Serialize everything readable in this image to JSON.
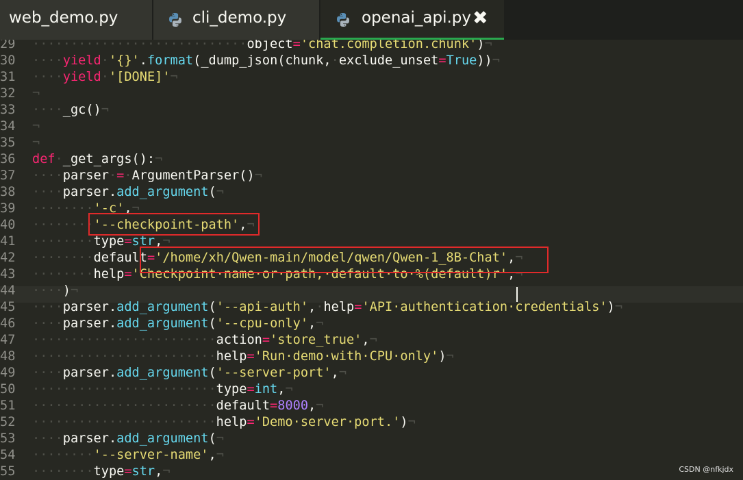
{
  "tabs": [
    {
      "label": "web_demo.py",
      "active": false,
      "icon": "python-icon"
    },
    {
      "label": "cli_demo.py",
      "active": false,
      "icon": "python-icon"
    },
    {
      "label": "openai_api.py",
      "active": true,
      "icon": "python-icon",
      "close": "✖"
    }
  ],
  "colors": {
    "keyword": "#f92672",
    "string": "#e6db74",
    "builtin": "#66d9ef",
    "number": "#ae81ff",
    "highlight_box": "#e02a2a",
    "active_tab_underline": "#2aa84e"
  },
  "lines": [
    {
      "n": "29",
      "t": "····························object='chat.completion.chunk')¬"
    },
    {
      "n": "30",
      "t": "····yield·'{}'.format(_dump_json(chunk,·exclude_unset=True))¬"
    },
    {
      "n": "31",
      "t": "····yield·'[DONE]'¬"
    },
    {
      "n": "32",
      "t": "¬"
    },
    {
      "n": "33",
      "t": "····_gc()¬"
    },
    {
      "n": "34",
      "t": "¬"
    },
    {
      "n": "35",
      "t": "¬"
    },
    {
      "n": "36",
      "t": "def·_get_args():¬"
    },
    {
      "n": "37",
      "t": "····parser·=·ArgumentParser()¬"
    },
    {
      "n": "38",
      "t": "····parser.add_argument(¬"
    },
    {
      "n": "39",
      "t": "········'-c',¬"
    },
    {
      "n": "40",
      "t": "········'--checkpoint-path',¬"
    },
    {
      "n": "41",
      "t": "········type=str,¬"
    },
    {
      "n": "42",
      "t": "········default='/home/xh/Qwen-main/model/qwen/Qwen-1_8B-Chat',¬"
    },
    {
      "n": "43",
      "t": "········help='Checkpoint·name·or·path,·default·to·%(default)r',¬"
    },
    {
      "n": "44",
      "t": "····)¬"
    },
    {
      "n": "45",
      "t": "····parser.add_argument('--api-auth',·help='API·authentication·credentials')¬"
    },
    {
      "n": "46",
      "t": "····parser.add_argument('--cpu-only',¬"
    },
    {
      "n": "47",
      "t": "························action='store_true',¬"
    },
    {
      "n": "48",
      "t": "························help='Run·demo·with·CPU·only')¬"
    },
    {
      "n": "49",
      "t": "····parser.add_argument('--server-port',¬"
    },
    {
      "n": "50",
      "t": "························type=int,¬"
    },
    {
      "n": "51",
      "t": "························default=8000,¬"
    },
    {
      "n": "52",
      "t": "························help='Demo·server·port.')¬"
    },
    {
      "n": "53",
      "t": "····parser.add_argument(¬"
    },
    {
      "n": "54",
      "t": "········'--server-name',¬"
    },
    {
      "n": "55",
      "t": "········type=str,¬"
    }
  ],
  "watermark": "CSDN @nfkjdx"
}
